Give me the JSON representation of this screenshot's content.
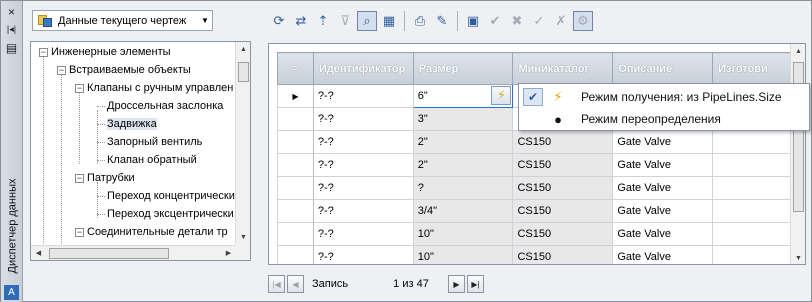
{
  "palette": {
    "title": "Диспетчер данных",
    "close_icon": "×",
    "autohide_icon": "|◂|",
    "menu_icon": "▤",
    "logo_icon": "A"
  },
  "source": {
    "selected": "Данные текущего чертеж"
  },
  "toolbar": {
    "buttons": [
      {
        "name": "refresh-icon",
        "glyph": "⟳"
      },
      {
        "name": "shuffle-icon",
        "glyph": "⇄"
      },
      {
        "name": "move-up-icon",
        "glyph": "⇡"
      },
      {
        "name": "filter-icon",
        "glyph": "⊽"
      },
      {
        "name": "zoom-icon",
        "glyph": "⌕"
      },
      {
        "name": "export-icon",
        "glyph": "▦"
      },
      {
        "name": "print-icon",
        "glyph": "⎙"
      },
      {
        "name": "edit-icon",
        "glyph": "✎"
      },
      {
        "name": "select-icon",
        "glyph": "▣"
      },
      {
        "name": "accept-icon",
        "glyph": "✔"
      },
      {
        "name": "reject-icon",
        "glyph": "✖"
      },
      {
        "name": "accept-all-icon",
        "glyph": "✓"
      },
      {
        "name": "reject-all-icon",
        "glyph": "✗"
      },
      {
        "name": "settings-icon",
        "glyph": "⚙"
      }
    ]
  },
  "tree": {
    "items": [
      {
        "label": "Инженерные элементы",
        "expander": "−"
      },
      {
        "label": "Встраиваемые объекты",
        "expander": "−"
      },
      {
        "label": "Клапаны с ручным управлен",
        "expander": "−"
      },
      {
        "label": "Дроссельная заслонка",
        "expander": ""
      },
      {
        "label": "Задвижка",
        "expander": ""
      },
      {
        "label": "Запорный вентиль",
        "expander": ""
      },
      {
        "label": "Клапан обратный",
        "expander": ""
      },
      {
        "label": "Патрубки",
        "expander": "−"
      },
      {
        "label": "Переход концентрически",
        "expander": ""
      },
      {
        "label": "Переход эксцентрически",
        "expander": ""
      },
      {
        "label": "Соединительные детали тр",
        "expander": "−"
      }
    ]
  },
  "grid": {
    "zoom_header_icon": "⌕",
    "columns": [
      "Идентификатор",
      "Размер",
      "Миникаталог",
      "Описание",
      "Изготови"
    ],
    "rows": [
      {
        "marker": "▶",
        "id": "?-?",
        "size": "6\"",
        "catalog": "",
        "desc": ""
      },
      {
        "marker": "",
        "id": "?-?",
        "size": "3\"",
        "catalog": "",
        "desc": ""
      },
      {
        "marker": "",
        "id": "?-?",
        "size": "2\"",
        "catalog": "CS150",
        "desc": "Gate Valve"
      },
      {
        "marker": "",
        "id": "?-?",
        "size": "2\"",
        "catalog": "CS150",
        "desc": "Gate Valve"
      },
      {
        "marker": "",
        "id": "?-?",
        "size": "?",
        "catalog": "CS150",
        "desc": "Gate Valve"
      },
      {
        "marker": "",
        "id": "?-?",
        "size": "3/4\"",
        "catalog": "CS150",
        "desc": "Gate Valve"
      },
      {
        "marker": "",
        "id": "?-?",
        "size": "10\"",
        "catalog": "CS150",
        "desc": "Gate Valve"
      },
      {
        "marker": "",
        "id": "?-?",
        "size": "10\"",
        "catalog": "CS150",
        "desc": "Gate Valve"
      }
    ],
    "edit_button_icon": "⚡"
  },
  "popup": {
    "items": [
      {
        "check": "✔",
        "icon": "⚡",
        "label": "Режим получения: из PipeLines.Size"
      },
      {
        "check": "",
        "icon": "●",
        "label": "Режим переопределения"
      }
    ]
  },
  "navigator": {
    "label": "Запись",
    "position": "1 из 47",
    "first": "|◀",
    "prev": "◀",
    "next": "▶",
    "last": "▶|"
  }
}
